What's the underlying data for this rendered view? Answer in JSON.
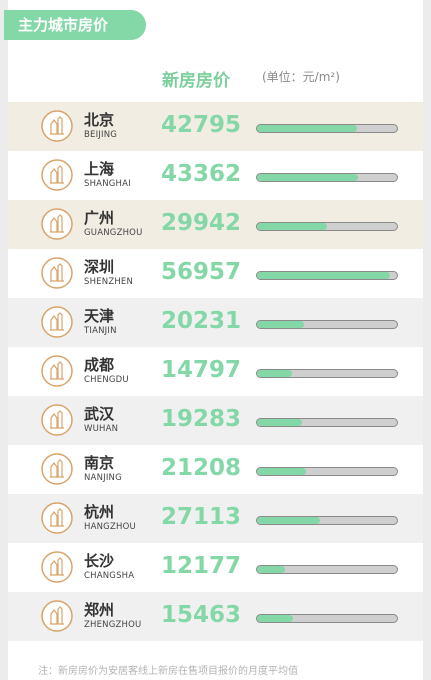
{
  "header": {
    "tab_title": "主力城市房价",
    "column_label": "新房房价",
    "unit_label": "(单位：元/m²)"
  },
  "chart_data": {
    "type": "bar",
    "title": "主力城市房价",
    "value_label": "新房房价",
    "unit": "元/m²",
    "xlim": [
      0,
      60000
    ],
    "categories": [
      "北京",
      "上海",
      "广州",
      "深圳",
      "天津",
      "成都",
      "武汉",
      "南京",
      "杭州",
      "长沙",
      "郑州"
    ],
    "categories_en": [
      "BEIJING",
      "SHANGHAI",
      "GUANGZHOU",
      "SHENZHEN",
      "TIANJIN",
      "CHENGDU",
      "WUHAN",
      "NANJING",
      "HANGZHOU",
      "CHANGSHA",
      "ZHENGZHOU"
    ],
    "values": [
      42795,
      43362,
      29942,
      56957,
      20231,
      14797,
      19283,
      21208,
      27113,
      12177,
      15463
    ]
  },
  "rows": [
    {
      "cn": "北京",
      "en": "BEIJING",
      "price": "42795",
      "icon": "beijing-landmark-icon"
    },
    {
      "cn": "上海",
      "en": "SHANGHAI",
      "price": "43362",
      "icon": "shanghai-towers-icon"
    },
    {
      "cn": "广州",
      "en": "GUANGZHOU",
      "price": "29942",
      "icon": "guangzhou-statue-icon"
    },
    {
      "cn": "深圳",
      "en": "SHENZHEN",
      "price": "56957",
      "icon": "shenzhen-tower-icon"
    },
    {
      "cn": "天津",
      "en": "TIANJIN",
      "price": "20231",
      "icon": "tianjin-ferris-wheel-icon"
    },
    {
      "cn": "成都",
      "en": "CHENGDU",
      "price": "14797",
      "icon": "chengdu-panda-icon"
    },
    {
      "cn": "武汉",
      "en": "WUHAN",
      "price": "19283",
      "icon": "wuhan-pagoda-icon"
    },
    {
      "cn": "南京",
      "en": "NANJING",
      "price": "21208",
      "icon": "nanjing-building-icon"
    },
    {
      "cn": "杭州",
      "en": "HANGZHOU",
      "price": "27113",
      "icon": "hangzhou-pagoda-icon"
    },
    {
      "cn": "长沙",
      "en": "CHANGSHA",
      "price": "12177",
      "icon": "changsha-tower-icon"
    },
    {
      "cn": "郑州",
      "en": "ZHENGZHOU",
      "price": "15463",
      "icon": "zhengzhou-pagoda-icon"
    }
  ],
  "footnote": "注：新房房价为安居客线上新房在售项目报价的月度平均值",
  "colors": {
    "accent_green": "#84d7a6",
    "icon_stroke": "#d9a36a",
    "row_beige": "#f2ede3",
    "row_gray": "#f0f0f0"
  }
}
